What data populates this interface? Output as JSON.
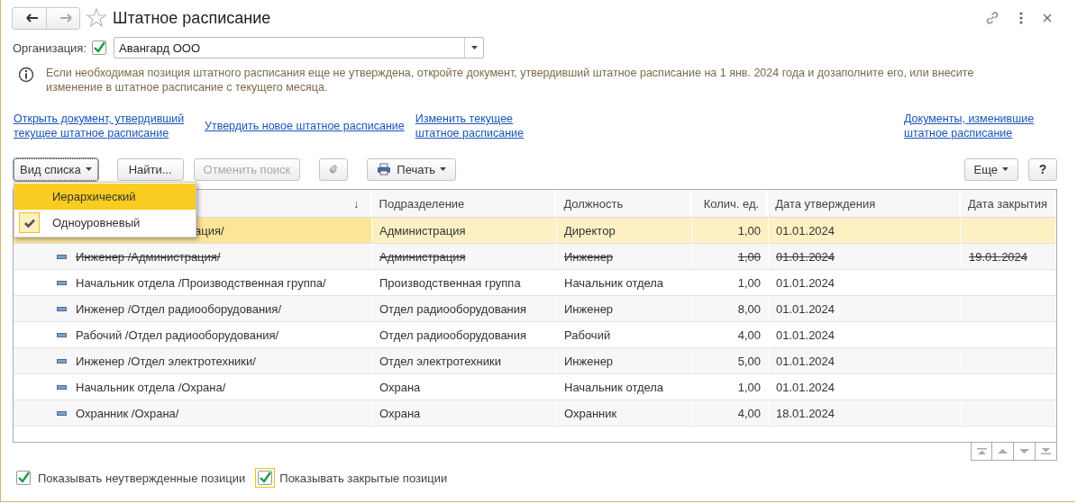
{
  "window": {
    "title": "Штатное расписание",
    "favorite": false
  },
  "organization": {
    "label": "Организация:",
    "checked": true,
    "value": "Авангард ООО"
  },
  "info": "Если необходимая позиция штатного расписания еще не утверждена, откройте документ, утвердивший штатное расписание на 1 янв. 2024 года и дозаполните его, или внесите изменение в штатное расписание с текущего месяца.",
  "links_left": [
    "Открыть документ, утвердивший текущее штатное расписание",
    "Утвердить новое штатное расписание",
    "Изменить текущее штатное расписание"
  ],
  "links_right": [
    "Документы, изменившие штатное расписание"
  ],
  "toolbar": {
    "view_button": {
      "label": "Вид списка",
      "pressed": true
    },
    "find_button": {
      "label": "Найти...",
      "disabled": false
    },
    "cancel_search_button": {
      "label": "Отменить поиск",
      "disabled": true
    },
    "print_button": {
      "label": "Печать"
    },
    "more_button": {
      "label": "Еще"
    },
    "help_button": {
      "label": "?"
    }
  },
  "view_menu": {
    "items": [
      {
        "label": "Иерархический",
        "selected": false,
        "hovered": true
      },
      {
        "label": "Одноуровневый",
        "selected": true,
        "hovered": false
      }
    ]
  },
  "table": {
    "sort_mark": "↓",
    "columns": [
      "Подразделение",
      "Должность",
      "Колич. ед.",
      "Дата утверждения",
      "Дата закрытия"
    ],
    "rows": [
      {
        "name": "ация/",
        "partly_covered": true,
        "department": "Администрация",
        "position": "Директор",
        "quantity": "1,00",
        "approved": "01.01.2024",
        "closed_date": "",
        "selected": true,
        "struck": false
      },
      {
        "name": "Инженер /Администрация/",
        "partly_covered": false,
        "department": "Администрация",
        "position": "Инженер",
        "quantity": "1,00",
        "approved": "01.01.2024",
        "closed_date": "19.01.2024",
        "selected": false,
        "struck": true
      },
      {
        "name": "Начальник отдела /Производственная группа/",
        "partly_covered": false,
        "department": "Производственная группа",
        "position": "Начальник отдела",
        "quantity": "1,00",
        "approved": "01.01.2024",
        "closed_date": "",
        "selected": false,
        "struck": false
      },
      {
        "name": "Инженер /Отдел радиооборудования/",
        "partly_covered": false,
        "department": "Отдел радиооборудования",
        "position": "Инженер",
        "quantity": "8,00",
        "approved": "01.01.2024",
        "closed_date": "",
        "selected": false,
        "struck": false
      },
      {
        "name": "Рабочий /Отдел радиооборудования/",
        "partly_covered": false,
        "department": "Отдел радиооборудования",
        "position": "Рабочий",
        "quantity": "4,00",
        "approved": "01.01.2024",
        "closed_date": "",
        "selected": false,
        "struck": false
      },
      {
        "name": "Инженер /Отдел электротехники/",
        "partly_covered": false,
        "department": "Отдел электротехники",
        "position": "Инженер",
        "quantity": "5,00",
        "approved": "01.01.2024",
        "closed_date": "",
        "selected": false,
        "struck": false
      },
      {
        "name": "Начальник отдела /Охрана/",
        "partly_covered": false,
        "department": "Охрана",
        "position": "Начальник отдела",
        "quantity": "1,00",
        "approved": "01.01.2024",
        "closed_date": "",
        "selected": false,
        "struck": false
      },
      {
        "name": "Охранник /Охрана/",
        "partly_covered": false,
        "department": "Охрана",
        "position": "Охранник",
        "quantity": "4,00",
        "approved": "18.01.2024",
        "closed_date": "",
        "selected": false,
        "struck": false
      }
    ]
  },
  "footer_checkboxes": [
    {
      "label": "Показывать неутвержденные позиции",
      "checked": true,
      "focused": false
    },
    {
      "label": "Показывать закрытые позиции",
      "checked": true,
      "focused": true
    }
  ]
}
